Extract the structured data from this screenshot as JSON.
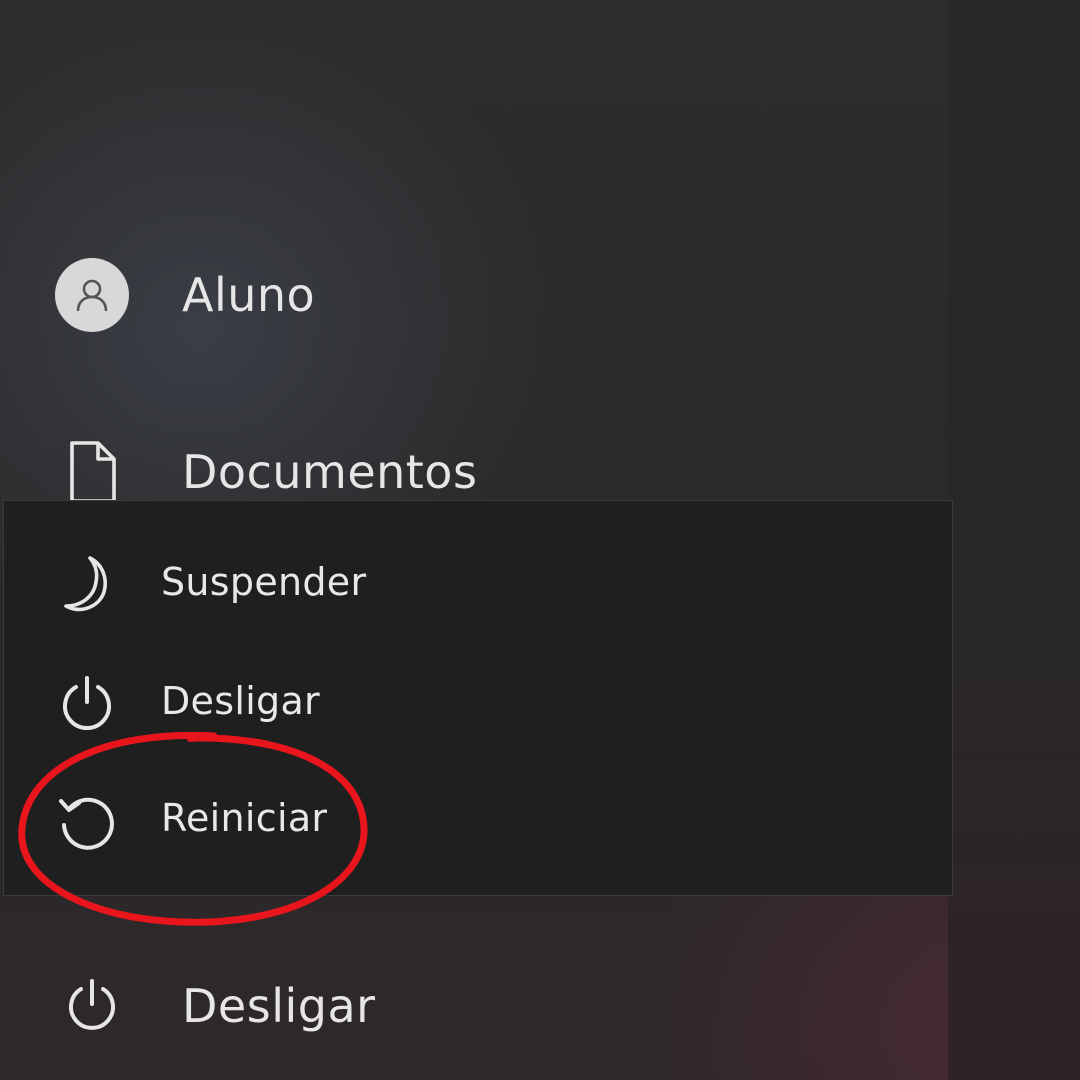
{
  "start_menu": {
    "user": {
      "label": "Aluno",
      "icon": "user-avatar-icon"
    },
    "documents": {
      "label": "Documentos",
      "icon": "document-icon"
    },
    "power": {
      "label": "Desligar",
      "icon": "power-icon"
    }
  },
  "power_menu": {
    "items": [
      {
        "label": "Suspender",
        "icon": "moon-icon"
      },
      {
        "label": "Desligar",
        "icon": "power-icon"
      },
      {
        "label": "Reiniciar",
        "icon": "restart-icon"
      }
    ],
    "highlighted_item": "Reiniciar",
    "highlight_color": "#e8161c"
  },
  "colors": {
    "menu_background": "#1f1f1f",
    "text": "#e8e8e8"
  }
}
